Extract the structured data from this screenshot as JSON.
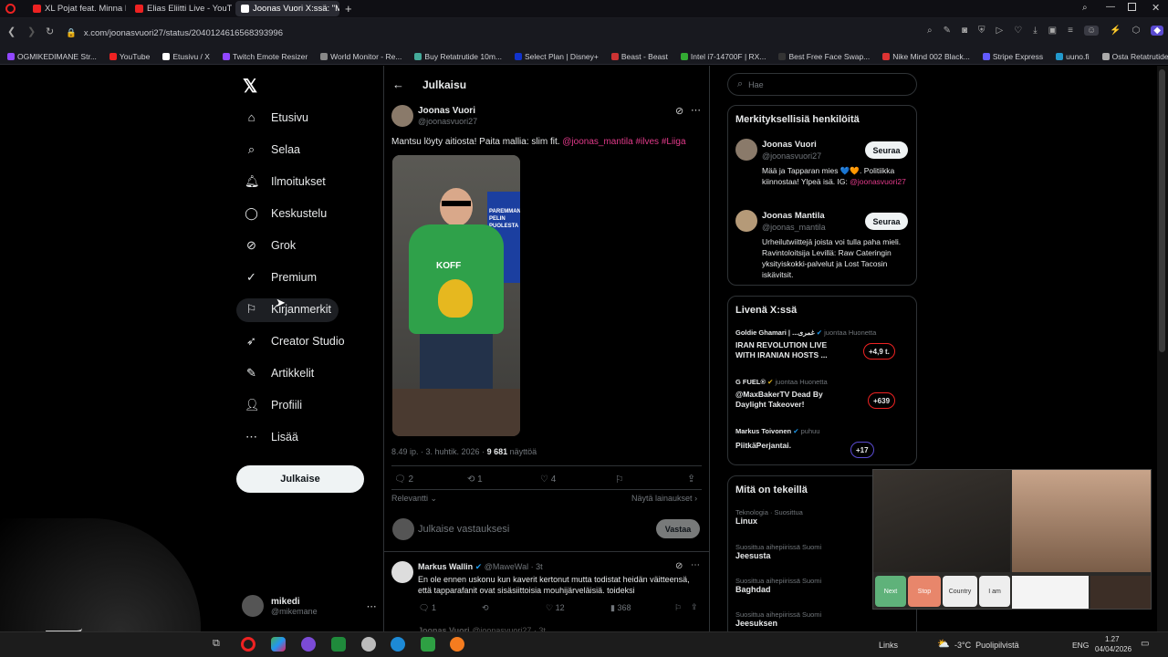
{
  "tabs": [
    {
      "title": "XL Pojat feat. Minna Paju"
    },
    {
      "title": "Elias Eliitti Live - YouT"
    },
    {
      "title": "Joonas Vuori X:ssä: \"Mant"
    }
  ],
  "url": "x.com/joonasvuori27/status/2040124616568393996",
  "bookmarks": [
    "OGMIKEDIMANE Str...",
    "YouTube",
    "Etusivu / X",
    "Twitch Emote Resizer",
    "World Monitor - Re...",
    "Buy Retatrutide 10m...",
    "Select Plan | Disney+",
    "Beast - Beast",
    "Intel i7-14700F | RX...",
    "Best Free Face Swap...",
    "Nike Mind 002 Black...",
    "Stripe Express",
    "uuno.fi",
    "Osta Retatrutidea | T..."
  ],
  "nav": {
    "items": [
      "Etusivu",
      "Selaa",
      "Ilmoitukset",
      "Keskustelu",
      "Grok",
      "Premium",
      "Kirjanmerkit",
      "Creator Studio",
      "Artikkelit",
      "Profiili",
      "Lisää"
    ],
    "post_button": "Julkaise"
  },
  "account": {
    "name": "mikedi",
    "handle": "@mikemane"
  },
  "header": {
    "title": "Julkaisu"
  },
  "post": {
    "author": "Joonas Vuori",
    "handle": "@joonasvuori27",
    "text_plain": "Mantsu löyty aitiosta! Paita mallia: slim fit.",
    "text_tags": "@joonas_mantila #ilves #Liiga",
    "image_text_1": "PAREMMAN PELIN PUOLESTA",
    "image_text_2": "KOFF",
    "time": "8.49 ip. · 3. huhtik. 2026 ·",
    "views": "9 681",
    "views_label": "näyttöä",
    "replies": "2",
    "reposts": "1",
    "likes": "4",
    "sort": "Relevantti",
    "show_quotes": "Näytä lainaukset"
  },
  "composer": {
    "placeholder": "Julkaise vastauksesi",
    "reply_button": "Vastaa"
  },
  "reply": {
    "author": "Markus Wallin",
    "handle": "@MaweWal · 3t",
    "text": "En ole ennen uskonu kun kaverit kertonut mutta todistat heidän väitteensä, että tapparafanit ovat sisäsiittoisia mouhijärveläisiä. toideksi",
    "replies": "1",
    "likes": "12",
    "views": "368"
  },
  "next_reply": {
    "author": "Joonas Vuori",
    "handle": "@joonasvuori27 · 3t"
  },
  "search": {
    "placeholder": "Hae"
  },
  "relevant": {
    "title": "Merkityksellisiä henkilöitä",
    "people": [
      {
        "name": "Joonas Vuori",
        "handle": "@joonasvuori27",
        "bio": "Mää ja Tapparan mies 💙🧡. Politiikka kiinnostaa! Ylpeä isä. IG:",
        "bio_link": "@joonasvuori27",
        "follow": "Seuraa"
      },
      {
        "name": "Joonas Mantila",
        "handle": "@joonas_mantila",
        "bio": "Urheilutwiittejä joista voi tulla paha mieli. Ravintoloitsija Levillä: Raw Cateringin yksityiskokki-palvelut ja Lost Tacosin iskävitsit.",
        "bio_link": "",
        "follow": "Seuraa"
      }
    ]
  },
  "live": {
    "title": "Livenä X:ssä",
    "items": [
      {
        "host": "Goldie Ghamari | ...غمری",
        "status": "juontaa Huonetta",
        "title": "IRAN REVOLUTION LIVE WITH IRANIAN HOSTS ...",
        "count": "+4,9 t."
      },
      {
        "host": "G FUEL®",
        "status": "juontaa Huonetta",
        "title": "@MaxBakerTV Dead By Daylight Takeover!",
        "count": "+639"
      },
      {
        "host": "Markus Toivonen",
        "status": "puhuu",
        "title": "PiitkäPerjantai.",
        "count": "+17"
      }
    ]
  },
  "trends": {
    "title": "Mitä on tekeillä",
    "items": [
      {
        "cat": "Teknologia · Suosittua",
        "name": "Linux"
      },
      {
        "cat": "Suosittua aihepiirissä Suomi",
        "name": "Jeesusta"
      },
      {
        "cat": "Suosittua aihepiirissä Suomi",
        "name": "Baghdad"
      },
      {
        "cat": "Suosittua aihepiirissä Suomi",
        "name": "Jeesuksen"
      }
    ]
  },
  "cam_buttons": [
    "Next",
    "Stop",
    "Country",
    "I am"
  ],
  "taskbar": {
    "links": "Links",
    "weather": "-3°C  Puolipilvistä",
    "lang": "ENG",
    "time": "1.27",
    "date": "04/04/2026"
  },
  "colors": {
    "accent_pink": "#e23a8a",
    "background": "#000000",
    "border": "#2f3336"
  }
}
